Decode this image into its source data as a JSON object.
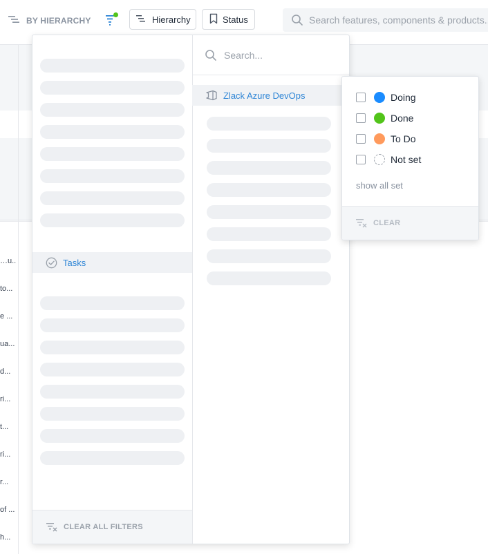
{
  "toolbar": {
    "view_mode_label": "BY HIERARCHY",
    "filter_active": true,
    "hierarchy_button_label": "Hierarchy",
    "status_button_label": "Status",
    "search_placeholder": "Search features, components & products..."
  },
  "background_rows": [
    {
      "text": "…u..."
    },
    {
      "text": "to..."
    },
    {
      "text": "e ..."
    },
    {
      "text": "ua..."
    },
    {
      "text": "d..."
    },
    {
      "text": "ri..."
    },
    {
      "text": "t..."
    },
    {
      "text": "ri..."
    },
    {
      "text": "r..."
    },
    {
      "text": "of ..."
    },
    {
      "text": "h..."
    }
  ],
  "hierarchy_panel": {
    "group_label": "Tasks",
    "clear_all_label": "CLEAR ALL FILTERS",
    "search_placeholder": "Search...",
    "source_label": "Zlack Azure DevOps",
    "loading_placeholder_count_top": 8,
    "loading_placeholder_count_bottom": 8,
    "loading_placeholder_count_right": 8
  },
  "status_popover": {
    "options": [
      {
        "label": "Doing",
        "color": "#1a8cff",
        "checked": false
      },
      {
        "label": "Done",
        "color": "#52c41a",
        "checked": false
      },
      {
        "label": "To Do",
        "color": "#ff9a5c",
        "checked": false
      },
      {
        "label": "Not set",
        "color": "none",
        "checked": false
      }
    ],
    "show_all_label": "show all set",
    "clear_label": "CLEAR"
  },
  "colors": {
    "accent_link": "#2f86d6",
    "filter_indicator": "#52c41a"
  }
}
